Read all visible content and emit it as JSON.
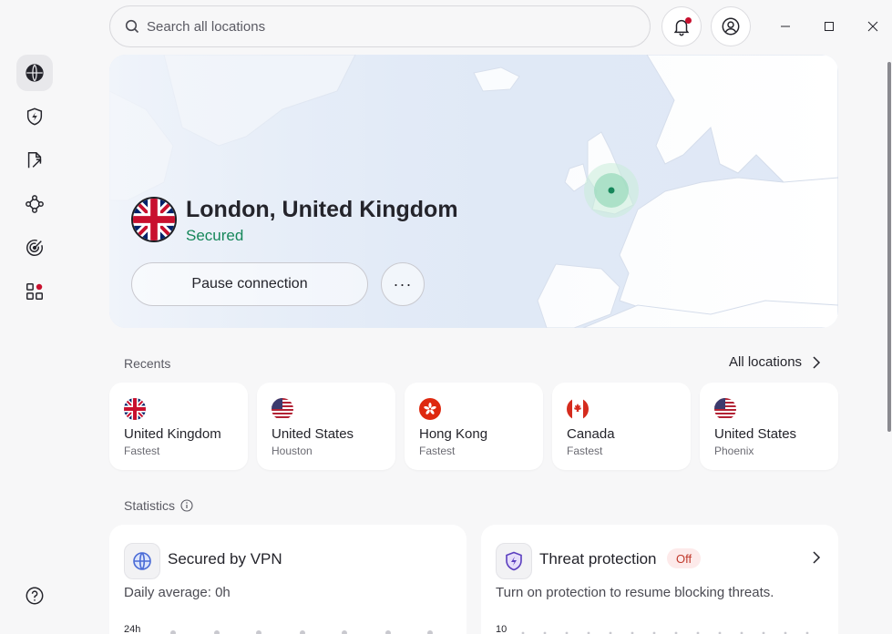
{
  "search": {
    "placeholder": "Search all locations"
  },
  "sidebar": {
    "items": [
      {
        "icon": "globe-icon",
        "active": true
      },
      {
        "icon": "shield-bolt-icon"
      },
      {
        "icon": "file-share-icon"
      },
      {
        "icon": "meshnet-icon"
      },
      {
        "icon": "radar-icon"
      },
      {
        "icon": "apps-icon",
        "badge": true
      }
    ],
    "help_icon": "help-icon"
  },
  "header": {
    "notifications_icon": "bell-icon",
    "account_icon": "account-icon"
  },
  "connection": {
    "location": "London, United Kingdom",
    "status": "Secured",
    "pause_label": "Pause connection",
    "more_label": "···"
  },
  "recents": {
    "label": "Recents",
    "all_locations_label": "All locations",
    "items": [
      {
        "country": "United Kingdom",
        "detail": "Fastest",
        "flag": "uk"
      },
      {
        "country": "United States",
        "detail": "Houston",
        "flag": "us"
      },
      {
        "country": "Hong Kong",
        "detail": "Fastest",
        "flag": "hk"
      },
      {
        "country": "Canada",
        "detail": "Fastest",
        "flag": "ca"
      },
      {
        "country": "United States",
        "detail": "Phoenix",
        "flag": "us"
      }
    ]
  },
  "statistics": {
    "label": "Statistics",
    "vpn": {
      "title": "Secured by VPN",
      "daily_prefix": "Daily average:",
      "daily_value": "0h",
      "axis_top": "24h"
    },
    "threat": {
      "title": "Threat protection",
      "badge": "Off",
      "description": "Turn on protection to resume blocking threats.",
      "axis_top": "10"
    }
  },
  "colors": {
    "accent_green": "#16875a",
    "badge_red": "#c8102e",
    "map_water": "#e6eef8",
    "land": "#ffffff"
  }
}
